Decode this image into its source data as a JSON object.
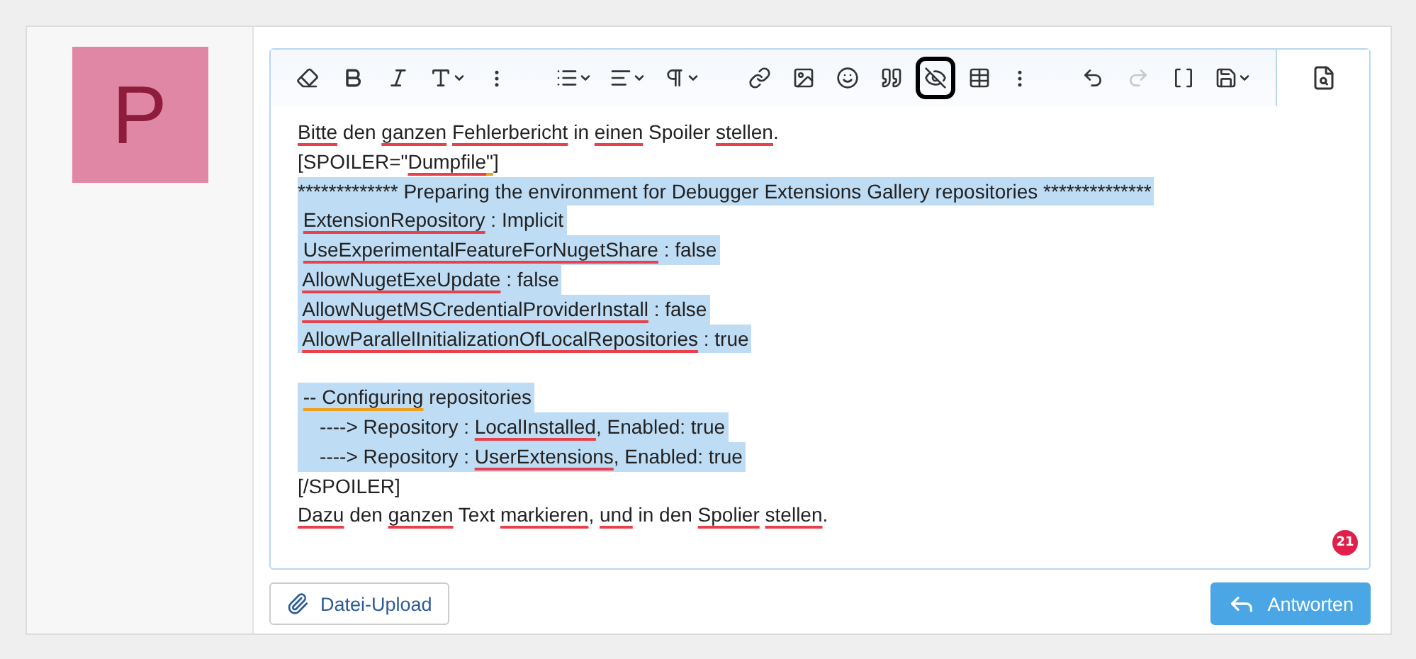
{
  "avatar": {
    "letter": "P"
  },
  "toolbar": {
    "items": [
      {
        "dropdown": false,
        "disabled": false,
        "highlighted": false
      },
      {
        "dropdown": false,
        "disabled": false,
        "highlighted": false
      },
      {
        "dropdown": false,
        "disabled": false,
        "highlighted": false
      },
      {
        "dropdown": true,
        "disabled": false,
        "highlighted": false
      },
      {
        "dropdown": false,
        "disabled": false,
        "highlighted": false
      },
      {
        "dropdown": true,
        "disabled": false,
        "highlighted": false
      },
      {
        "dropdown": true,
        "disabled": false,
        "highlighted": false
      },
      {
        "dropdown": true,
        "disabled": false,
        "highlighted": false
      },
      {
        "dropdown": false,
        "disabled": false,
        "highlighted": false
      },
      {
        "dropdown": false,
        "disabled": false,
        "highlighted": false
      },
      {
        "dropdown": false,
        "disabled": false,
        "highlighted": false
      },
      {
        "dropdown": false,
        "disabled": false,
        "highlighted": false
      },
      {
        "dropdown": false,
        "disabled": false,
        "highlighted": true
      },
      {
        "dropdown": false,
        "disabled": false,
        "highlighted": false
      },
      {
        "dropdown": false,
        "disabled": false,
        "highlighted": false
      },
      {
        "dropdown": false,
        "disabled": false,
        "highlighted": false
      },
      {
        "dropdown": false,
        "disabled": true,
        "highlighted": false
      },
      {
        "dropdown": false,
        "disabled": false,
        "highlighted": false
      },
      {
        "dropdown": true,
        "disabled": false,
        "highlighted": false
      }
    ]
  },
  "lines": [
    {
      "kind": "text",
      "selected": false,
      "segments": [
        {
          "text": "Bitte",
          "misspelled": true
        },
        {
          "text": " den"
        },
        {
          "text": " ganzen",
          "misspelled": true
        },
        {
          "text": " Fehlerbericht",
          "misspelled": true
        },
        {
          "text": " in"
        },
        {
          "text": " einen",
          "misspelled": true
        },
        {
          "text": " Spoiler"
        },
        {
          "text": " stellen",
          "misspelled": true
        },
        {
          "text": "."
        }
      ]
    },
    {
      "kind": "text",
      "selected": false,
      "segments": [
        {
          "text": "[SPOILER=\""
        },
        {
          "text": "Dumpfile",
          "misspelled": true
        },
        {
          "text": "\"",
          "grammar": true
        },
        {
          "text": "]"
        }
      ]
    },
    {
      "kind": "text",
      "selected": true,
      "segments": [
        {
          "text": "************* Preparing the environment for Debugger Extensions Gallery repositories **************"
        }
      ]
    },
    {
      "kind": "text",
      "selected": true,
      "segments": [
        {
          "text": " ExtensionRepository",
          "misspelled": true
        },
        {
          "text": " : Implicit"
        }
      ]
    },
    {
      "kind": "text",
      "selected": true,
      "segments": [
        {
          "text": " UseExperimentalFeatureForNugetShare",
          "misspelled": true
        },
        {
          "text": " : false"
        }
      ]
    },
    {
      "kind": "text",
      "selected": true,
      "segments": [
        {
          "text": " AllowNugetExeUpdate",
          "misspelled": true
        },
        {
          "text": " : false"
        }
      ]
    },
    {
      "kind": "text",
      "selected": true,
      "segments": [
        {
          "text": " AllowNugetMSCredentialProviderInstall",
          "misspelled": true
        },
        {
          "text": " : false"
        }
      ]
    },
    {
      "kind": "text",
      "selected": true,
      "segments": [
        {
          "text": " AllowParallelInitializationOfLocalRepositories",
          "misspelled": true
        },
        {
          "text": " : true"
        }
      ]
    },
    {
      "kind": "blank"
    },
    {
      "kind": "text",
      "selected": true,
      "segments": [
        {
          "text": " -- Configuring",
          "grammar": true
        },
        {
          "text": " repositories"
        }
      ]
    },
    {
      "kind": "text",
      "selected": true,
      "segments": [
        {
          "text": "    ----> Repository :"
        },
        {
          "text": " LocalInstalled",
          "misspelled": true
        },
        {
          "text": ", Enabled: true"
        }
      ]
    },
    {
      "kind": "text",
      "selected": true,
      "segments": [
        {
          "text": "    ----> Repository :"
        },
        {
          "text": " UserExtensions",
          "misspelled": true
        },
        {
          "text": ", Enabled: true"
        }
      ]
    },
    {
      "kind": "text",
      "selected": false,
      "segments": [
        {
          "text": "[/SPOILER]"
        }
      ]
    },
    {
      "kind": "text",
      "selected": false,
      "segments": [
        {
          "text": "Dazu",
          "misspelled": true
        },
        {
          "text": " den"
        },
        {
          "text": " ganzen",
          "misspelled": true
        },
        {
          "text": " Text"
        },
        {
          "text": " markieren",
          "misspelled": true
        },
        {
          "text": ","
        },
        {
          "text": " und",
          "misspelled": true
        },
        {
          "text": " in den"
        },
        {
          "text": " Spolier",
          "misspelled": true
        },
        {
          "text": " stellen",
          "misspelled": true
        },
        {
          "text": "."
        }
      ]
    }
  ],
  "counter": "21",
  "buttons": [
    {
      "kind": "upload",
      "label": "Datei-Upload"
    },
    {
      "kind": "reply",
      "label": "Antworten"
    }
  ]
}
